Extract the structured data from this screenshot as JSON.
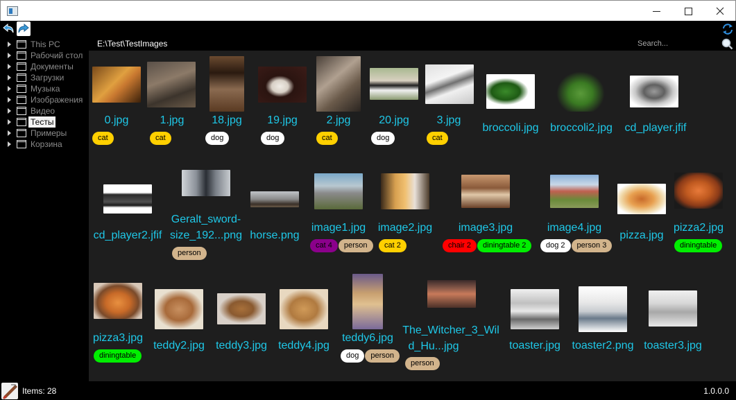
{
  "titlebar": {
    "minimize": "—",
    "maximize": "☐",
    "close": "✕"
  },
  "sidebar": {
    "items": [
      {
        "label": "This PC",
        "selected": false
      },
      {
        "label": "Рабочий стол",
        "selected": false
      },
      {
        "label": "Документы",
        "selected": false
      },
      {
        "label": "Загрузки",
        "selected": false
      },
      {
        "label": "Музыка",
        "selected": false
      },
      {
        "label": "Изображения",
        "selected": false
      },
      {
        "label": "Видео",
        "selected": false
      },
      {
        "label": "Тесты",
        "selected": true
      },
      {
        "label": "Примеры",
        "selected": false
      },
      {
        "label": "Корзина",
        "selected": false
      }
    ]
  },
  "main": {
    "path": "E:\\Test\\TestImages",
    "search_placeholder": "Search..."
  },
  "tag_colors": {
    "cat": "#ffd000",
    "dog": "#ffffff",
    "person": "#d2b48c",
    "chair": "#ff0000",
    "diningtable": "#00ee00",
    "cat_multi": "#8b008b"
  },
  "images": [
    {
      "name": "0.jpg",
      "tags": [
        "cat"
      ]
    },
    {
      "name": "1.jpg",
      "tags": [
        "cat"
      ]
    },
    {
      "name": "18.jpg",
      "tags": [
        "dog"
      ]
    },
    {
      "name": "19.jpg",
      "tags": [
        "dog"
      ]
    },
    {
      "name": "2.jpg",
      "tags": [
        "cat"
      ]
    },
    {
      "name": "20.jpg",
      "tags": [
        "dog"
      ]
    },
    {
      "name": "3.jpg",
      "tags": [
        "cat"
      ]
    },
    {
      "name": "broccoli.jpg",
      "tags": []
    },
    {
      "name": "broccoli2.jpg",
      "tags": []
    },
    {
      "name": "cd_player.jfif",
      "tags": []
    },
    {
      "name": "cd_player2.jfif",
      "tags": []
    },
    {
      "name": "Geralt_sword-",
      "name2": "size_192...png",
      "tags": [
        "person"
      ]
    },
    {
      "name": "horse.png",
      "tags": []
    },
    {
      "name": "image1.jpg",
      "tags": [
        "cat 4",
        "person"
      ]
    },
    {
      "name": "image2.jpg",
      "tags": [
        "cat 2"
      ]
    },
    {
      "name": "image3.jpg",
      "tags": [
        "chair 2",
        "diningtable 2"
      ]
    },
    {
      "name": "image4.jpg",
      "tags": [
        "dog 2",
        "person 3"
      ]
    },
    {
      "name": "pizza.jpg",
      "tags": []
    },
    {
      "name": "pizza2.jpg",
      "tags": [
        "diningtable"
      ]
    },
    {
      "name": "pizza3.jpg",
      "tags": [
        "diningtable"
      ]
    },
    {
      "name": "teddy2.jpg",
      "tags": []
    },
    {
      "name": "teddy3.jpg",
      "tags": []
    },
    {
      "name": "teddy4.jpg",
      "tags": []
    },
    {
      "name": "teddy6.jpg",
      "tags": [
        "dog",
        "person"
      ]
    },
    {
      "name": "The_Witcher_3_Wil",
      "name2": "d_Hu...jpg",
      "tags": [
        "person"
      ]
    },
    {
      "name": "toaster.jpg",
      "tags": []
    },
    {
      "name": "toaster2.png",
      "tags": []
    },
    {
      "name": "toaster3.jpg",
      "tags": []
    }
  ],
  "status": {
    "items": "Items: 28",
    "version": "1.0.0.0"
  }
}
